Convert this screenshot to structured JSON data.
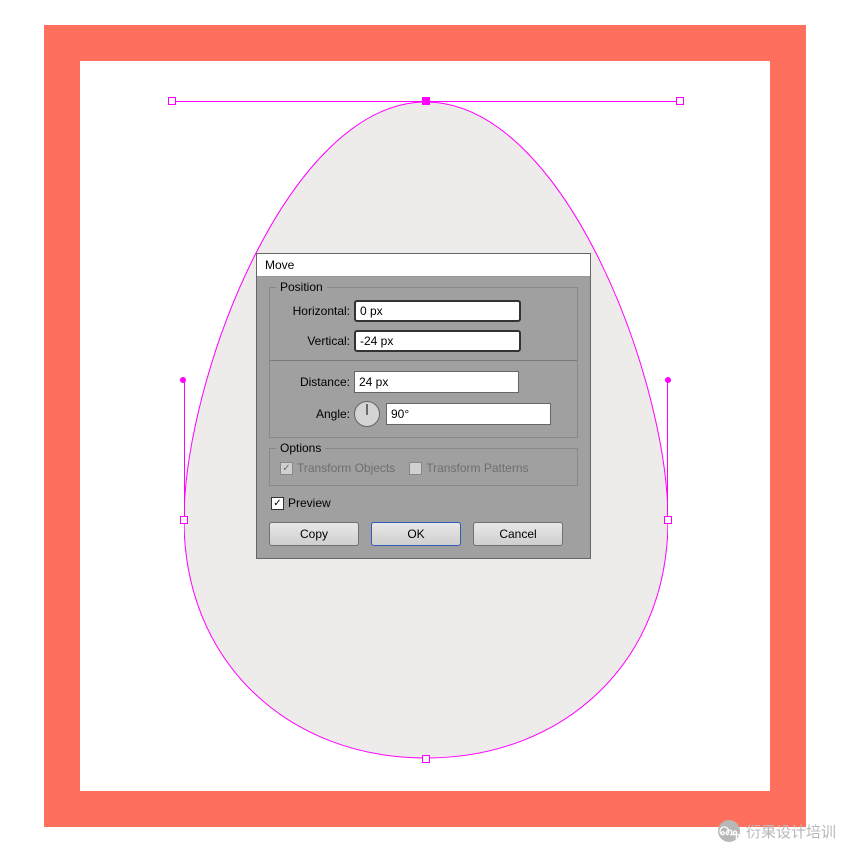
{
  "dialog": {
    "title": "Move",
    "position": {
      "legend": "Position",
      "horizontal_label": "Horizontal:",
      "horizontal_value": "0 px",
      "vertical_label": "Vertical:",
      "vertical_value": "-24 px",
      "distance_label": "Distance:",
      "distance_value": "24 px",
      "angle_label": "Angle:",
      "angle_value": "90°"
    },
    "options": {
      "legend": "Options",
      "transform_objects": "Transform Objects",
      "transform_patterns": "Transform Patterns"
    },
    "preview_label": "Preview",
    "buttons": {
      "copy": "Copy",
      "ok": "OK",
      "cancel": "Cancel"
    }
  },
  "watermark": {
    "text": "衍果设计培训"
  }
}
